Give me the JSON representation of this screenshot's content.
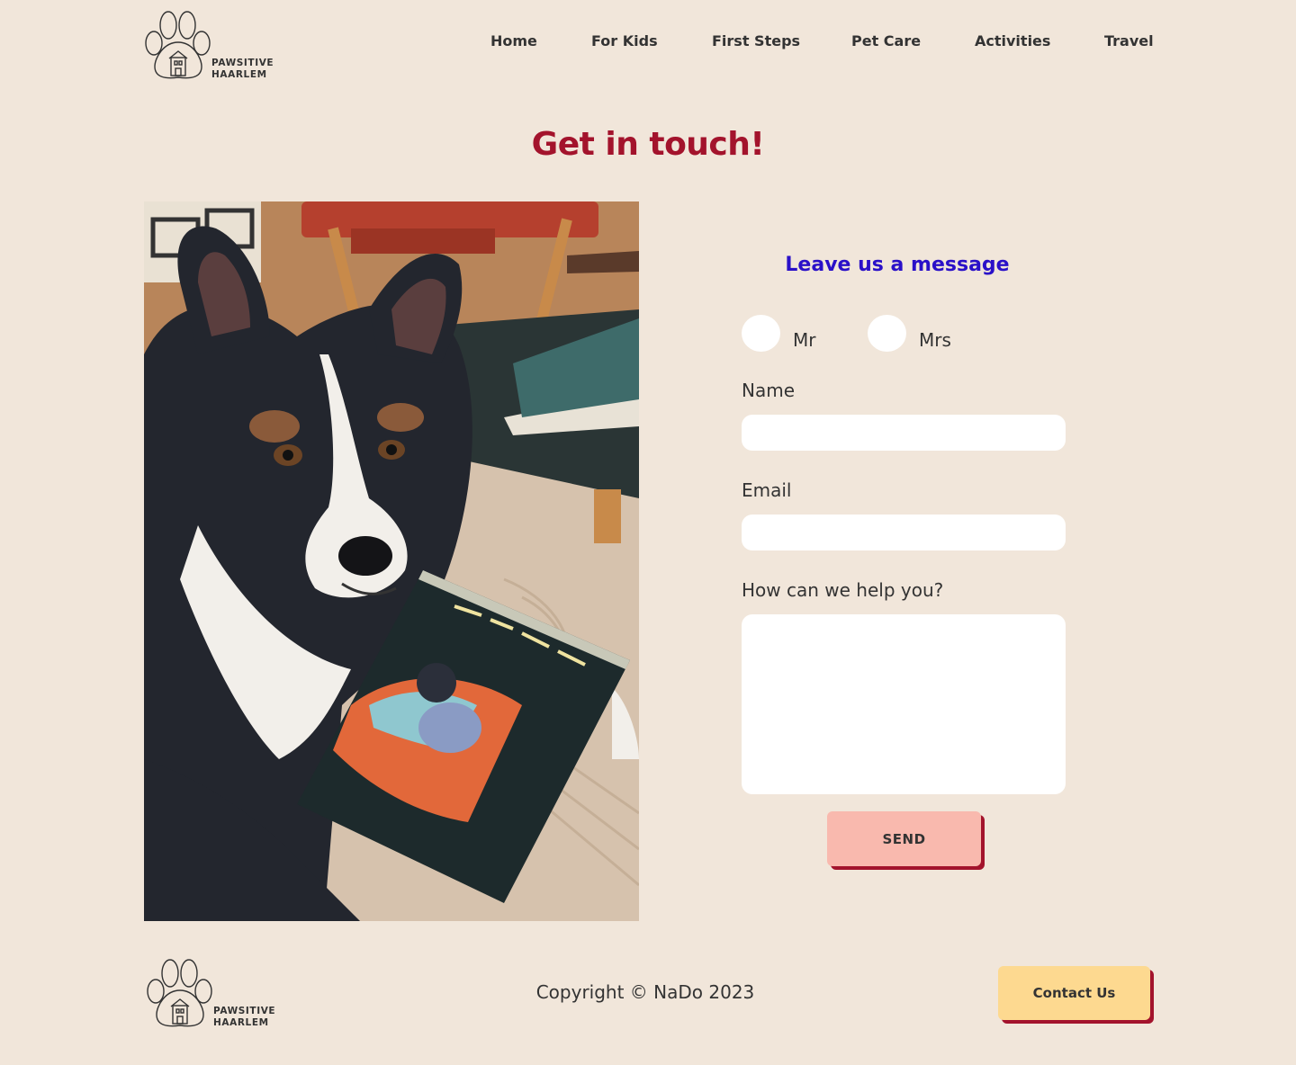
{
  "brand": {
    "logo_icon": "paw-house-icon",
    "name_line1": "PAWSITIVE",
    "name_line2": "HAARLEM"
  },
  "nav": {
    "items": [
      {
        "label": "Home"
      },
      {
        "label": "For Kids"
      },
      {
        "label": "First Steps"
      },
      {
        "label": "Pet Care"
      },
      {
        "label": "Activities"
      },
      {
        "label": "Travel"
      }
    ]
  },
  "page": {
    "title": "Get in touch!"
  },
  "photo": {
    "subject": "dog-with-book-illustration"
  },
  "form": {
    "title": "Leave us a message",
    "salutations": [
      {
        "label": "Mr"
      },
      {
        "label": "Mrs"
      }
    ],
    "name_label": "Name",
    "name_value": "",
    "email_label": "Email",
    "email_value": "",
    "message_label": "How can we help you?",
    "message_value": "",
    "send_label": "SEND"
  },
  "footer": {
    "copyright": "Copyright © NaDo 2023",
    "contact_label": "Contact Us"
  },
  "colors": {
    "background": "#f1e6da",
    "title_red": "#a3132c",
    "form_title_blue": "#2a10c8",
    "send_button": "#f9b9ae",
    "contact_button": "#fdd990",
    "button_shadow": "#a3132c"
  }
}
